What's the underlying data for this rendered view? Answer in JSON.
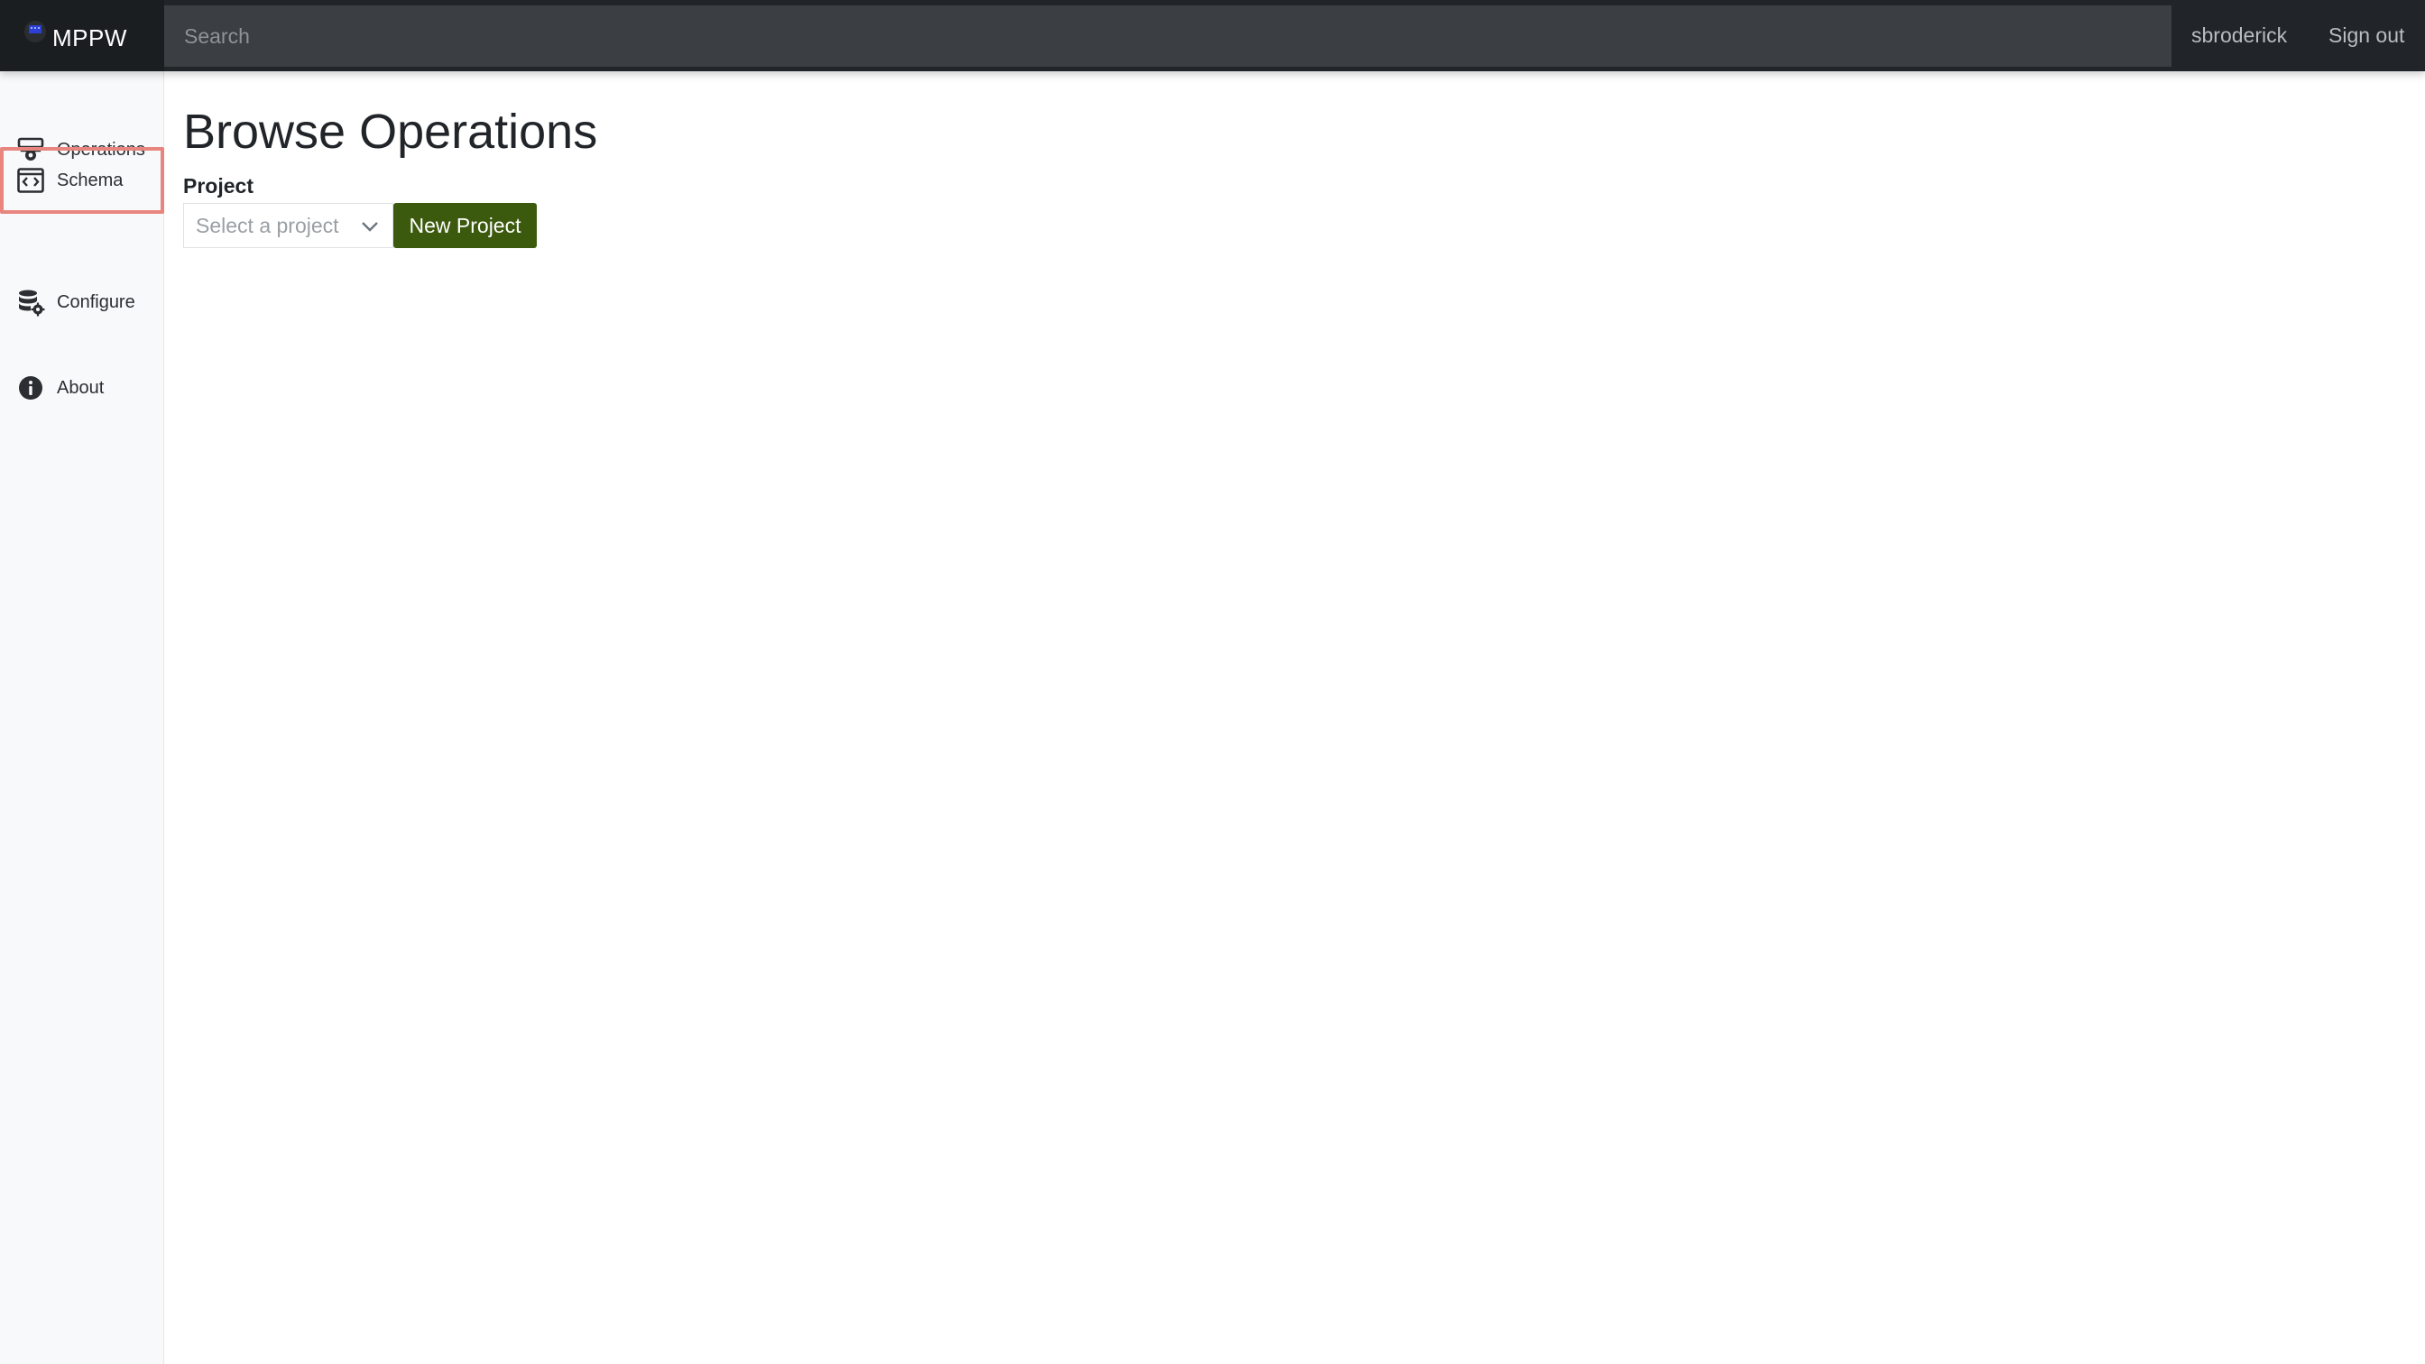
{
  "navbar": {
    "brand": "MPPW",
    "search_placeholder": "Search",
    "user": "sbroderick",
    "sign_out": "Sign out"
  },
  "sidebar": {
    "items": [
      {
        "label": "Operations",
        "icon": "operations-icon"
      },
      {
        "label": "Schema",
        "icon": "schema-icon",
        "highlighted": true
      },
      {
        "label": "Configure",
        "icon": "configure-icon"
      },
      {
        "label": "About",
        "icon": "info-icon"
      }
    ]
  },
  "main": {
    "title": "Browse Operations",
    "project_label": "Project",
    "project_placeholder": "Select a project",
    "new_project_label": "New Project"
  },
  "colors": {
    "navbar_bg": "#212529",
    "primary_button": "#3c5a0e",
    "highlight_border": "#e8857e"
  }
}
